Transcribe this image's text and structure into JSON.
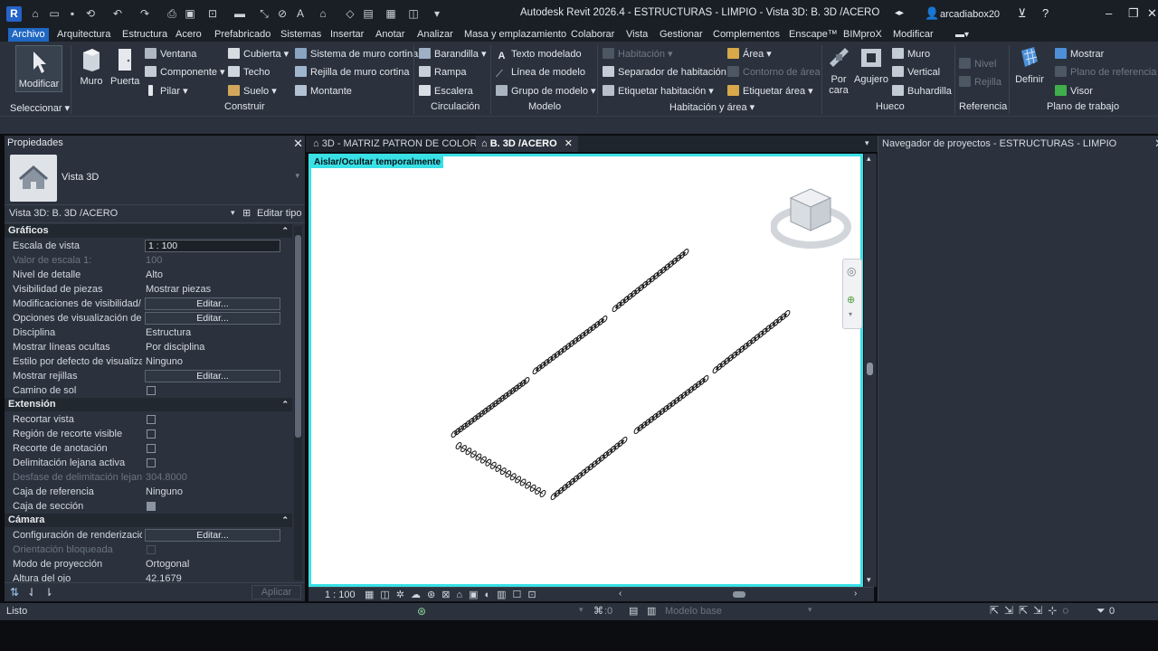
{
  "app": {
    "title": "Autodesk Revit 2026.4 - ESTRUCTURAS - LIMPIO - Vista 3D: B. 3D /ACERO",
    "logo": "R",
    "user": "arcadiabox20"
  },
  "colors": {
    "accent": "#1f67c2",
    "highlight": "#39e0e6",
    "panel": "#2b323d",
    "canvas": "#ffffff"
  },
  "menu": {
    "tabs": [
      "Archivo",
      "Arquitectura",
      "Estructura",
      "Acero",
      "Prefabricado",
      "Sistemas",
      "Insertar",
      "Anotar",
      "Analizar",
      "Masa y emplazamiento",
      "Colaborar",
      "Vista",
      "Gestionar",
      "Complementos",
      "Enscape™",
      "BIMproX",
      "Modificar"
    ]
  },
  "ribbon": {
    "modify": "Modificar",
    "select": "Seleccionar",
    "build": {
      "wall": "Muro",
      "door": "Puerta",
      "window": "Ventana",
      "component": "Componente",
      "column": "Pilar",
      "roof": "Cubierta",
      "ceiling": "Techo",
      "floor": "Suelo",
      "curtain_system": "Sistema de muro cortina",
      "curtain_grid": "Rejilla de muro cortina",
      "mullion": "Montante",
      "title": "Construir"
    },
    "circulation": {
      "railing": "Barandilla",
      "ramp": "Rampa",
      "stair": "Escalera",
      "title": "Circulación"
    },
    "model": {
      "model_text": "Texto modelado",
      "model_line": "Línea de modelo",
      "model_group": "Grupo de modelo",
      "title": "Modelo"
    },
    "room": {
      "room": "Habitación",
      "separator": "Separador de habitación",
      "tag_room": "Etiquetar habitación",
      "area": "Área",
      "area_boundary": "Contorno de área",
      "tag_area": "Etiquetar área",
      "title": "Habitación y área"
    },
    "opening": {
      "by_face": "Por cara",
      "shaft": "Agujero",
      "wall": "Muro",
      "vertical": "Vertical",
      "dormer": "Buhardilla",
      "title": "Hueco"
    },
    "datum": {
      "level": "Nivel",
      "grid": "Rejilla",
      "title": "Referencia"
    },
    "workplane": {
      "set": "Definir",
      "show": "Mostrar",
      "ref_plane": "Plano de referencia",
      "viewer": "Visor",
      "title": "Plano de trabajo"
    }
  },
  "properties": {
    "title": "Propiedades",
    "type": "Vista 3D",
    "view_selector": "Vista 3D: B. 3D /ACERO",
    "edit_type": "Editar tipo",
    "apply": "Aplicar",
    "sections": [
      {
        "name": "Gráficos",
        "rows": [
          {
            "k": "Escala de vista",
            "v": "1 : 100",
            "kind": "input"
          },
          {
            "k": "Valor de escala    1:",
            "v": "100",
            "kind": "text",
            "disabled": true
          },
          {
            "k": "Nivel de detalle",
            "v": "Alto",
            "kind": "text"
          },
          {
            "k": "Visibilidad de piezas",
            "v": "Mostrar piezas",
            "kind": "text"
          },
          {
            "k": "Modificaciones de visibilidad/...",
            "v": "Editar...",
            "kind": "button"
          },
          {
            "k": "Opciones de visualización de g...",
            "v": "Editar...",
            "kind": "button"
          },
          {
            "k": "Disciplina",
            "v": "Estructura",
            "kind": "text"
          },
          {
            "k": "Mostrar líneas ocultas",
            "v": "Por disciplina",
            "kind": "text"
          },
          {
            "k": "Estilo por defecto de visualizac...",
            "v": "Ninguno",
            "kind": "text"
          },
          {
            "k": "Mostrar rejillas",
            "v": "Editar...",
            "kind": "button"
          },
          {
            "k": "Camino de sol",
            "v": "",
            "kind": "check",
            "checked": false
          }
        ]
      },
      {
        "name": "Extensión",
        "rows": [
          {
            "k": "Recortar vista",
            "v": "",
            "kind": "check",
            "checked": false
          },
          {
            "k": "Región de recorte visible",
            "v": "",
            "kind": "check",
            "checked": false
          },
          {
            "k": "Recorte de anotación",
            "v": "",
            "kind": "check",
            "checked": false
          },
          {
            "k": "Delimitación lejana activa",
            "v": "",
            "kind": "check",
            "checked": false
          },
          {
            "k": "Desfase de delimitación lejano",
            "v": "304.8000",
            "kind": "text",
            "disabled": true
          },
          {
            "k": "Caja de referencia",
            "v": "Ninguno",
            "kind": "text"
          },
          {
            "k": "Caja de sección",
            "v": "",
            "kind": "check",
            "checked": true
          }
        ]
      },
      {
        "name": "Cámara",
        "rows": [
          {
            "k": "Configuración de renderización",
            "v": "Editar...",
            "kind": "button"
          },
          {
            "k": "Orientación bloqueada",
            "v": "",
            "kind": "check",
            "checked": false,
            "disabled": true
          },
          {
            "k": "Modo de proyección",
            "v": "Ortogonal",
            "kind": "text"
          },
          {
            "k": "Altura del ojo",
            "v": "42.1679",
            "kind": "text"
          }
        ]
      }
    ]
  },
  "views": {
    "tabs": [
      {
        "label": "3D - MATRIZ PATRON DE COLOR",
        "active": false
      },
      {
        "label": "B. 3D /ACERO",
        "active": true
      }
    ],
    "isolate_banner": "Aislar/Ocultar temporalmente",
    "scale": "1 : 100"
  },
  "browser": {
    "title": "Navegador de proyectos - ESTRUCTURAS - LIMPIO"
  },
  "status": {
    "text": "Listo",
    "model": "Modelo base",
    "count1": ":0",
    "count2": "0"
  }
}
